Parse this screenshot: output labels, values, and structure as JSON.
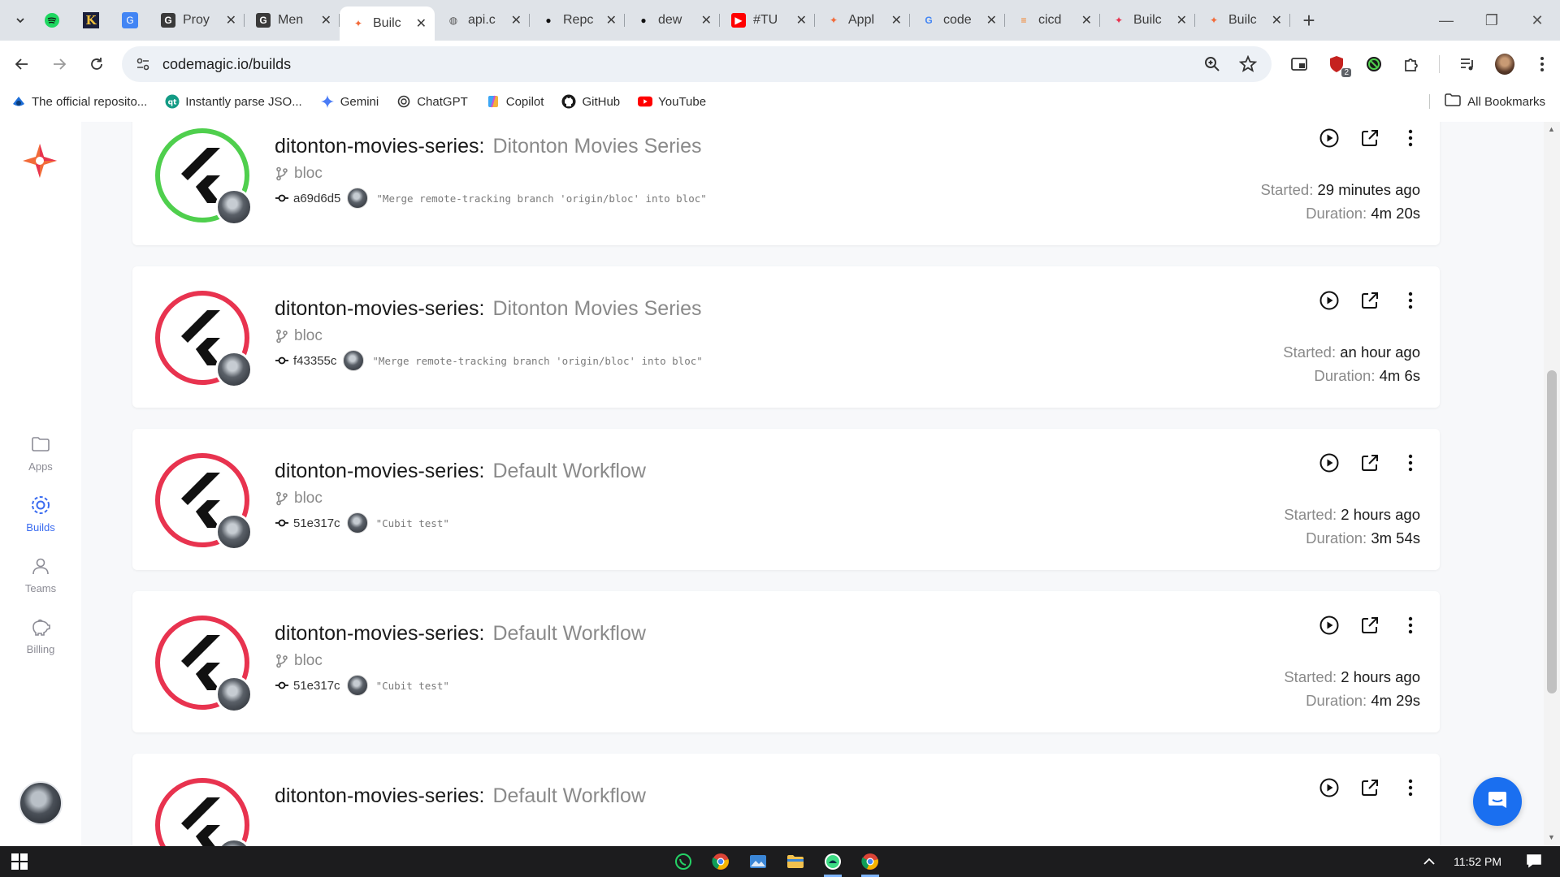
{
  "browser": {
    "tabs": [
      {
        "title": "Proy",
        "icon": "proxy-g-icon",
        "fav_bg": "#3a3a3a",
        "fav_fg": "#ffffff",
        "fav_text": "G",
        "active": false
      },
      {
        "title": "Men",
        "icon": "proxy-g-icon",
        "fav_bg": "#3a3a3a",
        "fav_fg": "#ffffff",
        "fav_text": "G",
        "active": false
      },
      {
        "title": "Builc",
        "icon": "codemagic-icon",
        "fav_bg": "transparent",
        "fav_fg": "#f26b3a",
        "fav_text": "✦",
        "active": true
      },
      {
        "title": "api.c",
        "icon": "globe-icon",
        "fav_bg": "transparent",
        "fav_fg": "#555555",
        "fav_text": "◍",
        "active": false
      },
      {
        "title": "Repc",
        "icon": "github-icon",
        "fav_bg": "transparent",
        "fav_fg": "#111111",
        "fav_text": "●",
        "active": false
      },
      {
        "title": "dew",
        "icon": "github-icon",
        "fav_bg": "transparent",
        "fav_fg": "#111111",
        "fav_text": "●",
        "active": false
      },
      {
        "title": "#TU",
        "icon": "youtube-icon",
        "fav_bg": "#ff0000",
        "fav_fg": "#ffffff",
        "fav_text": "▶",
        "active": false
      },
      {
        "title": "Appl",
        "icon": "codemagic-icon",
        "fav_bg": "transparent",
        "fav_fg": "#f26b3a",
        "fav_text": "✦",
        "active": false
      },
      {
        "title": "code",
        "icon": "google-icon",
        "fav_bg": "transparent",
        "fav_fg": "#4285f4",
        "fav_text": "G",
        "active": false
      },
      {
        "title": "cicd",
        "icon": "stackoverflow-icon",
        "fav_bg": "transparent",
        "fav_fg": "#f48024",
        "fav_text": "≡",
        "active": false
      },
      {
        "title": "Builc",
        "icon": "codemagic-icon",
        "fav_bg": "transparent",
        "fav_fg": "#e8334f",
        "fav_text": "✦",
        "active": false
      },
      {
        "title": "Builc",
        "icon": "codemagic-icon",
        "fav_bg": "transparent",
        "fav_fg": "#f26b3a",
        "fav_text": "✦",
        "active": false
      }
    ],
    "url": "codemagic.io/builds",
    "extension_badge": "2",
    "bookmarks": [
      {
        "label": "The official reposito...",
        "icon": "wordpress-icon"
      },
      {
        "label": "Instantly parse JSO...",
        "icon": "quicktype-icon"
      },
      {
        "label": "Gemini",
        "icon": "gemini-icon"
      },
      {
        "label": "ChatGPT",
        "icon": "chatgpt-icon"
      },
      {
        "label": "Copilot",
        "icon": "copilot-icon"
      },
      {
        "label": "GitHub",
        "icon": "github-icon"
      },
      {
        "label": "YouTube",
        "icon": "youtube-icon"
      }
    ],
    "all_bookmarks": "All Bookmarks"
  },
  "sidebar": {
    "items": [
      {
        "label": "Apps",
        "icon": "folder-icon",
        "active": false
      },
      {
        "label": "Builds",
        "icon": "builds-gear-icon",
        "active": true
      },
      {
        "label": "Teams",
        "icon": "person-icon",
        "active": false
      },
      {
        "label": "Billing",
        "icon": "piggy-bank-icon",
        "active": false
      }
    ]
  },
  "builds": [
    {
      "app": "ditonton-movies-series:",
      "workflow": "Ditonton Movies Series",
      "branch": "bloc",
      "commit": "a69d6d5",
      "message": "\"Merge remote-tracking branch 'origin/bloc' into bloc\"",
      "status": "success",
      "started_label": "Started:",
      "started": "29 minutes ago",
      "duration_label": "Duration:",
      "duration": "4m 20s"
    },
    {
      "app": "ditonton-movies-series:",
      "workflow": "Ditonton Movies Series",
      "branch": "bloc",
      "commit": "f43355c",
      "message": "\"Merge remote-tracking branch 'origin/bloc' into bloc\"",
      "status": "failed",
      "started_label": "Started:",
      "started": "an hour ago",
      "duration_label": "Duration:",
      "duration": "4m 6s"
    },
    {
      "app": "ditonton-movies-series:",
      "workflow": "Default Workflow",
      "branch": "bloc",
      "commit": "51e317c",
      "message": "\"Cubit test\"",
      "status": "failed",
      "started_label": "Started:",
      "started": "2 hours ago",
      "duration_label": "Duration:",
      "duration": "3m 54s"
    },
    {
      "app": "ditonton-movies-series:",
      "workflow": "Default Workflow",
      "branch": "bloc",
      "commit": "51e317c",
      "message": "\"Cubit test\"",
      "status": "failed",
      "started_label": "Started:",
      "started": "2 hours ago",
      "duration_label": "Duration:",
      "duration": "4m 29s"
    },
    {
      "app": "ditonton-movies-series:",
      "workflow": "Default Workflow",
      "branch": "",
      "commit": "",
      "message": "",
      "status": "failed",
      "started_label": "",
      "started": "",
      "duration_label": "",
      "duration": ""
    }
  ],
  "colors": {
    "success": "#4fcf4d",
    "failed": "#e8334f",
    "accent": "#3b6cf0",
    "brand": "#f26b3a"
  },
  "taskbar": {
    "apps": [
      "whatsapp-icon",
      "chrome-icon",
      "photos-icon",
      "file-explorer-icon",
      "android-studio-icon",
      "chrome-icon"
    ],
    "time": "11:52 PM"
  }
}
